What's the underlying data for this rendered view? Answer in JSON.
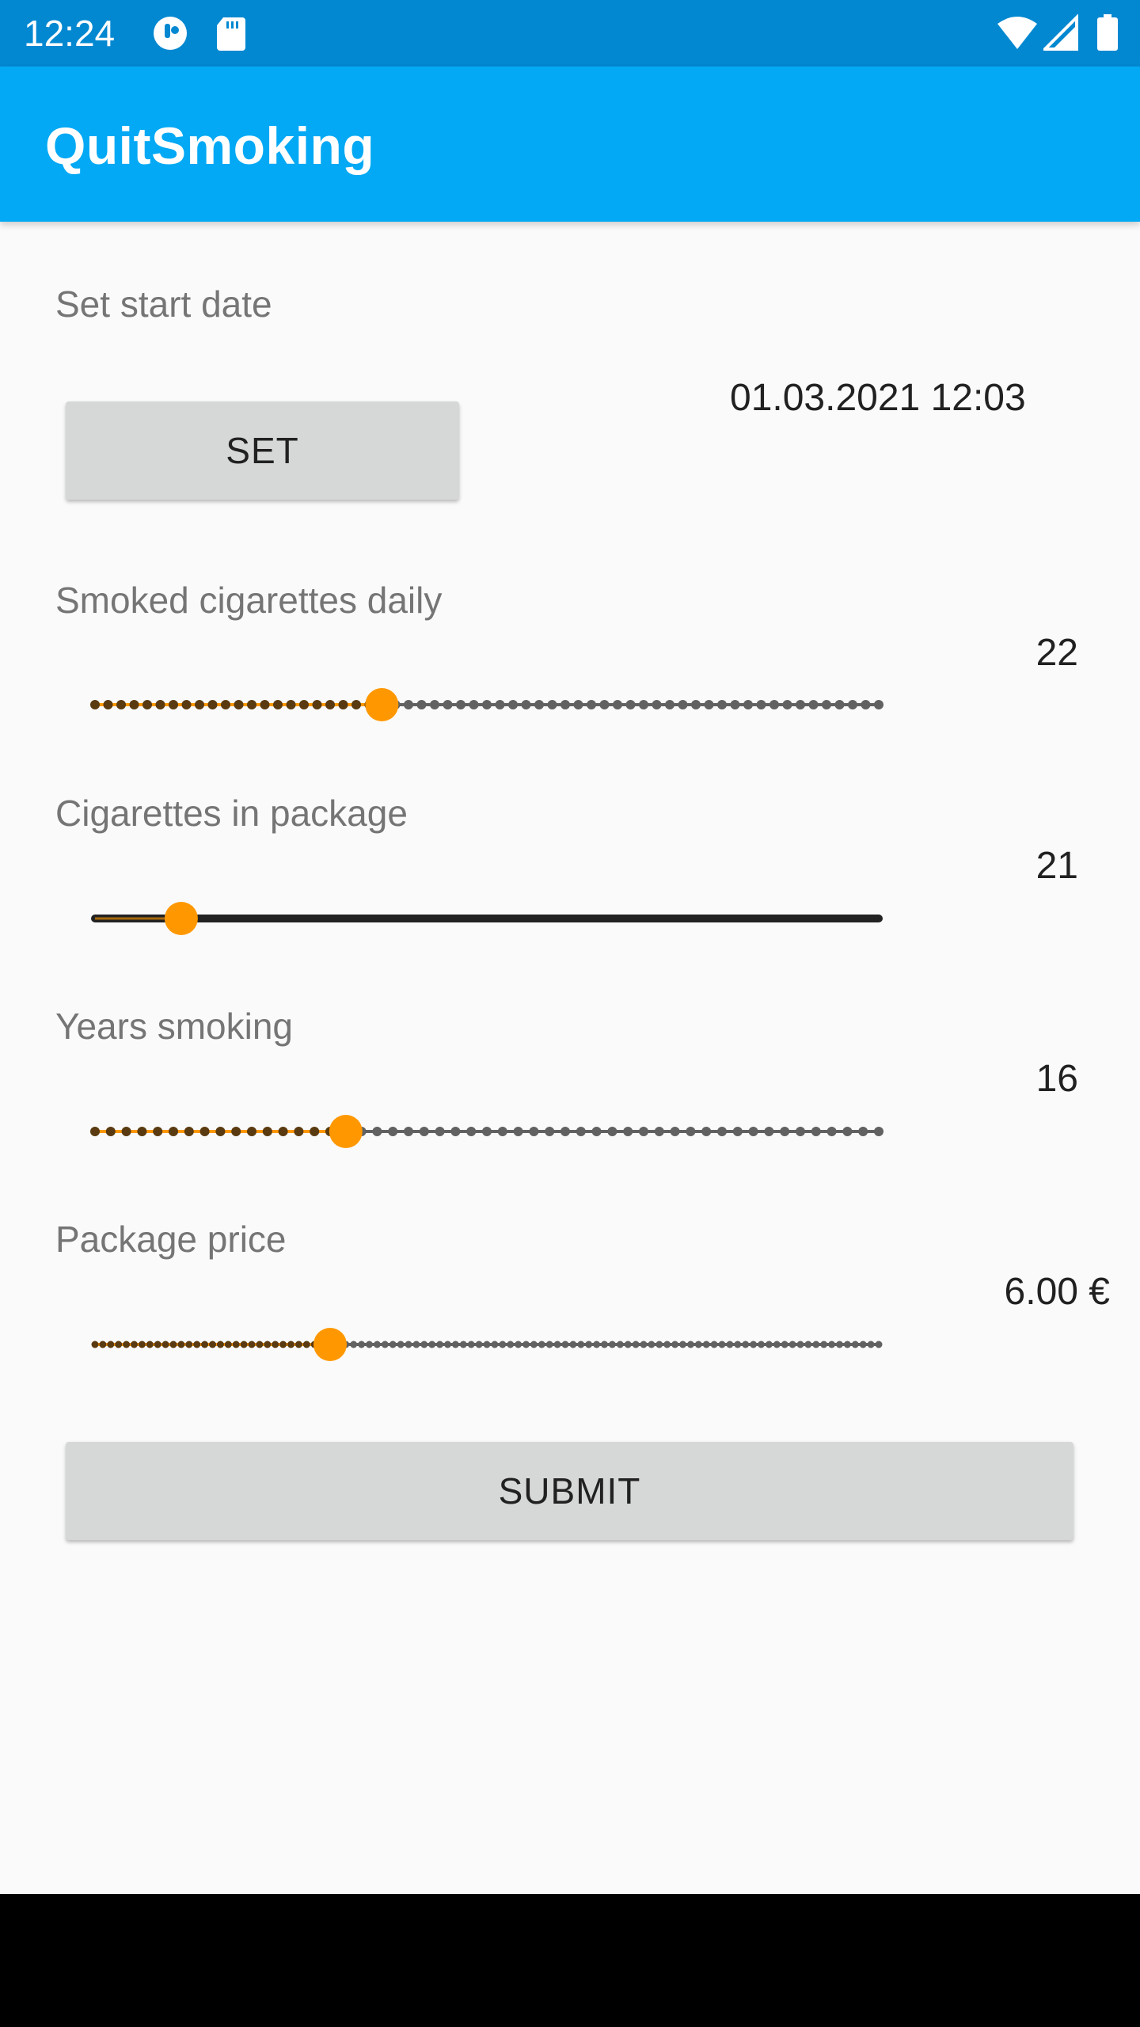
{
  "status_bar": {
    "time": "12:24",
    "icons": [
      "data-saver-icon",
      "sd-card-icon",
      "wifi-icon",
      "cell-signal-icon",
      "battery-icon"
    ]
  },
  "app_bar": {
    "title": "QuitSmoking"
  },
  "start_date": {
    "label": "Set start date",
    "button_label": "SET",
    "value": "01.03.2021 12:03"
  },
  "sliders": [
    {
      "label": "Smoked cigarettes daily",
      "value_text": "22",
      "fraction": 0.366,
      "ticks": 60
    },
    {
      "label": "Cigarettes in package",
      "value_text": "21",
      "fraction": 0.11,
      "ticks": 0
    },
    {
      "label": "Years smoking",
      "value_text": "16",
      "fraction": 0.32,
      "ticks": 50
    },
    {
      "label": "Package price",
      "value_text": "6.00 €",
      "fraction": 0.3,
      "ticks": 100
    }
  ],
  "submit": {
    "label": "SUBMIT"
  },
  "colors": {
    "status_bar": "#0288d1",
    "app_bar": "#03a9f4",
    "accent": "#ff9800",
    "track": "#616161",
    "background": "#fafafa"
  }
}
